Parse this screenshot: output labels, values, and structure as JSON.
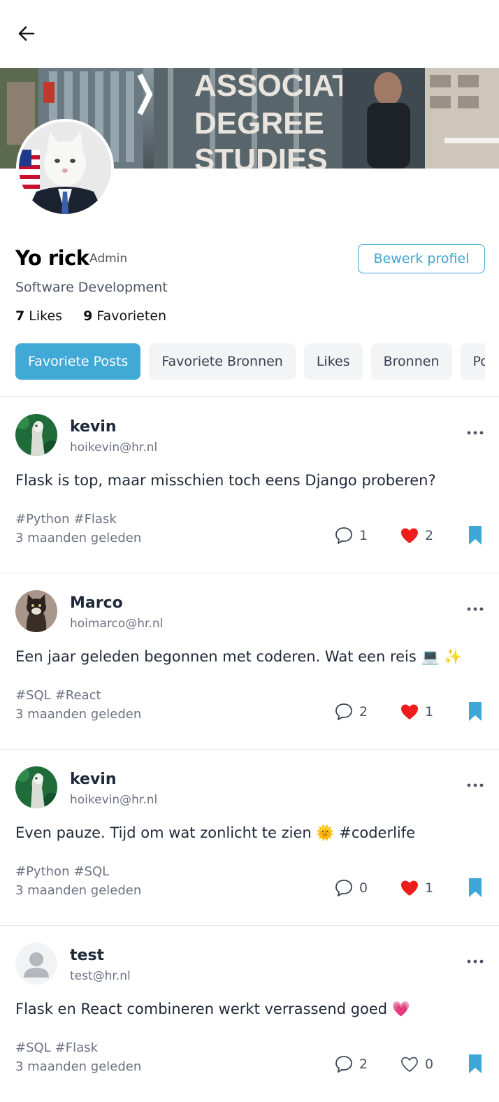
{
  "profile": {
    "name": "Yo rick",
    "role": "Admin",
    "edit_label": "Bewerk profiel",
    "study": "Software Development",
    "likes_count": "7",
    "likes_label": "Likes",
    "favorites_count": "9",
    "favorites_label": "Favorieten"
  },
  "banner": {
    "sign_lines": [
      "ASSOCIATE",
      "DEGREE",
      "STUDIES"
    ]
  },
  "tabs": [
    {
      "label": "Favoriete Posts",
      "active": true
    },
    {
      "label": "Favoriete Bronnen",
      "active": false
    },
    {
      "label": "Likes",
      "active": false
    },
    {
      "label": "Bronnen",
      "active": false
    },
    {
      "label": "Posts",
      "active": false
    }
  ],
  "posts": [
    {
      "user": "kevin",
      "email": "hoikevin@hr.nl",
      "content": "Flask is top, maar misschien toch eens Django proberen?",
      "tags": [
        "#Python",
        "#Flask"
      ],
      "time": "3 maanden geleden",
      "comments": "1",
      "likes": "2",
      "liked": true,
      "avatar": "llama"
    },
    {
      "user": "Marco",
      "email": "hoimarco@hr.nl",
      "content": "Een jaar geleden begonnen met coderen. Wat een reis 💻 ✨",
      "tags": [
        "#SQL",
        "#React"
      ],
      "time": "3 maanden geleden",
      "comments": "2",
      "likes": "1",
      "liked": true,
      "avatar": "cat"
    },
    {
      "user": "kevin",
      "email": "hoikevin@hr.nl",
      "content": "Even pauze. Tijd om wat zonlicht te zien 🌞 #coderlife",
      "tags": [
        "#Python",
        "#SQL"
      ],
      "time": "3 maanden geleden",
      "comments": "0",
      "likes": "1",
      "liked": true,
      "avatar": "llama"
    },
    {
      "user": "test",
      "email": "test@hr.nl",
      "content": "Flask en React combineren werkt verrassend goed 💗",
      "tags": [
        "#SQL",
        "#Flask"
      ],
      "time": "3 maanden geleden",
      "comments": "2",
      "likes": "0",
      "liked": false,
      "avatar": "default"
    }
  ],
  "colors": {
    "accent": "#40a9d5",
    "like_red": "#ef1c1c",
    "bookmark": "#3fa6d8"
  }
}
